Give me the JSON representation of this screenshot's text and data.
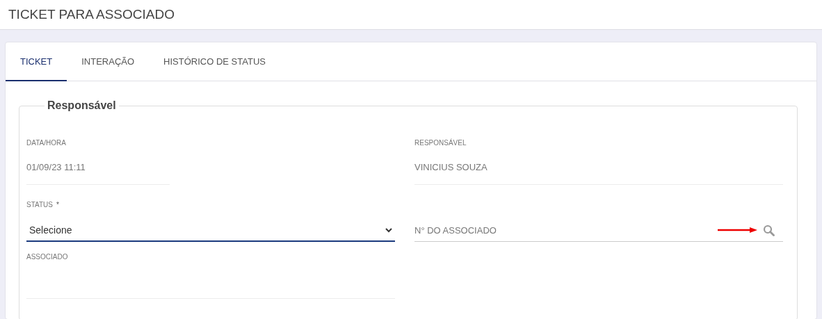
{
  "page_title": "TICKET PARA ASSOCIADO",
  "tabs": [
    {
      "label": "TICKET",
      "selected": true
    },
    {
      "label": "INTERAÇÃO",
      "selected": false
    },
    {
      "label": "HISTÓRICO DE STATUS",
      "selected": false
    }
  ],
  "section": {
    "legend": "Responsável",
    "fields": [
      {
        "kind": "readonly",
        "label": "DATA/HORA",
        "value": "01/09/23 11:11",
        "compact": true
      },
      {
        "kind": "readonly",
        "label": "RESPONSÁVEL",
        "value": "VINICIUS SOUZA"
      },
      {
        "kind": "select",
        "label": "STATUS",
        "required_mark": "*",
        "value": "Selecione",
        "focused": true
      },
      {
        "kind": "search",
        "placeholder": "N° DO ASSOCIADO",
        "annotated": true
      },
      {
        "kind": "readonly",
        "label": "ASSOCIADO"
      }
    ]
  }
}
